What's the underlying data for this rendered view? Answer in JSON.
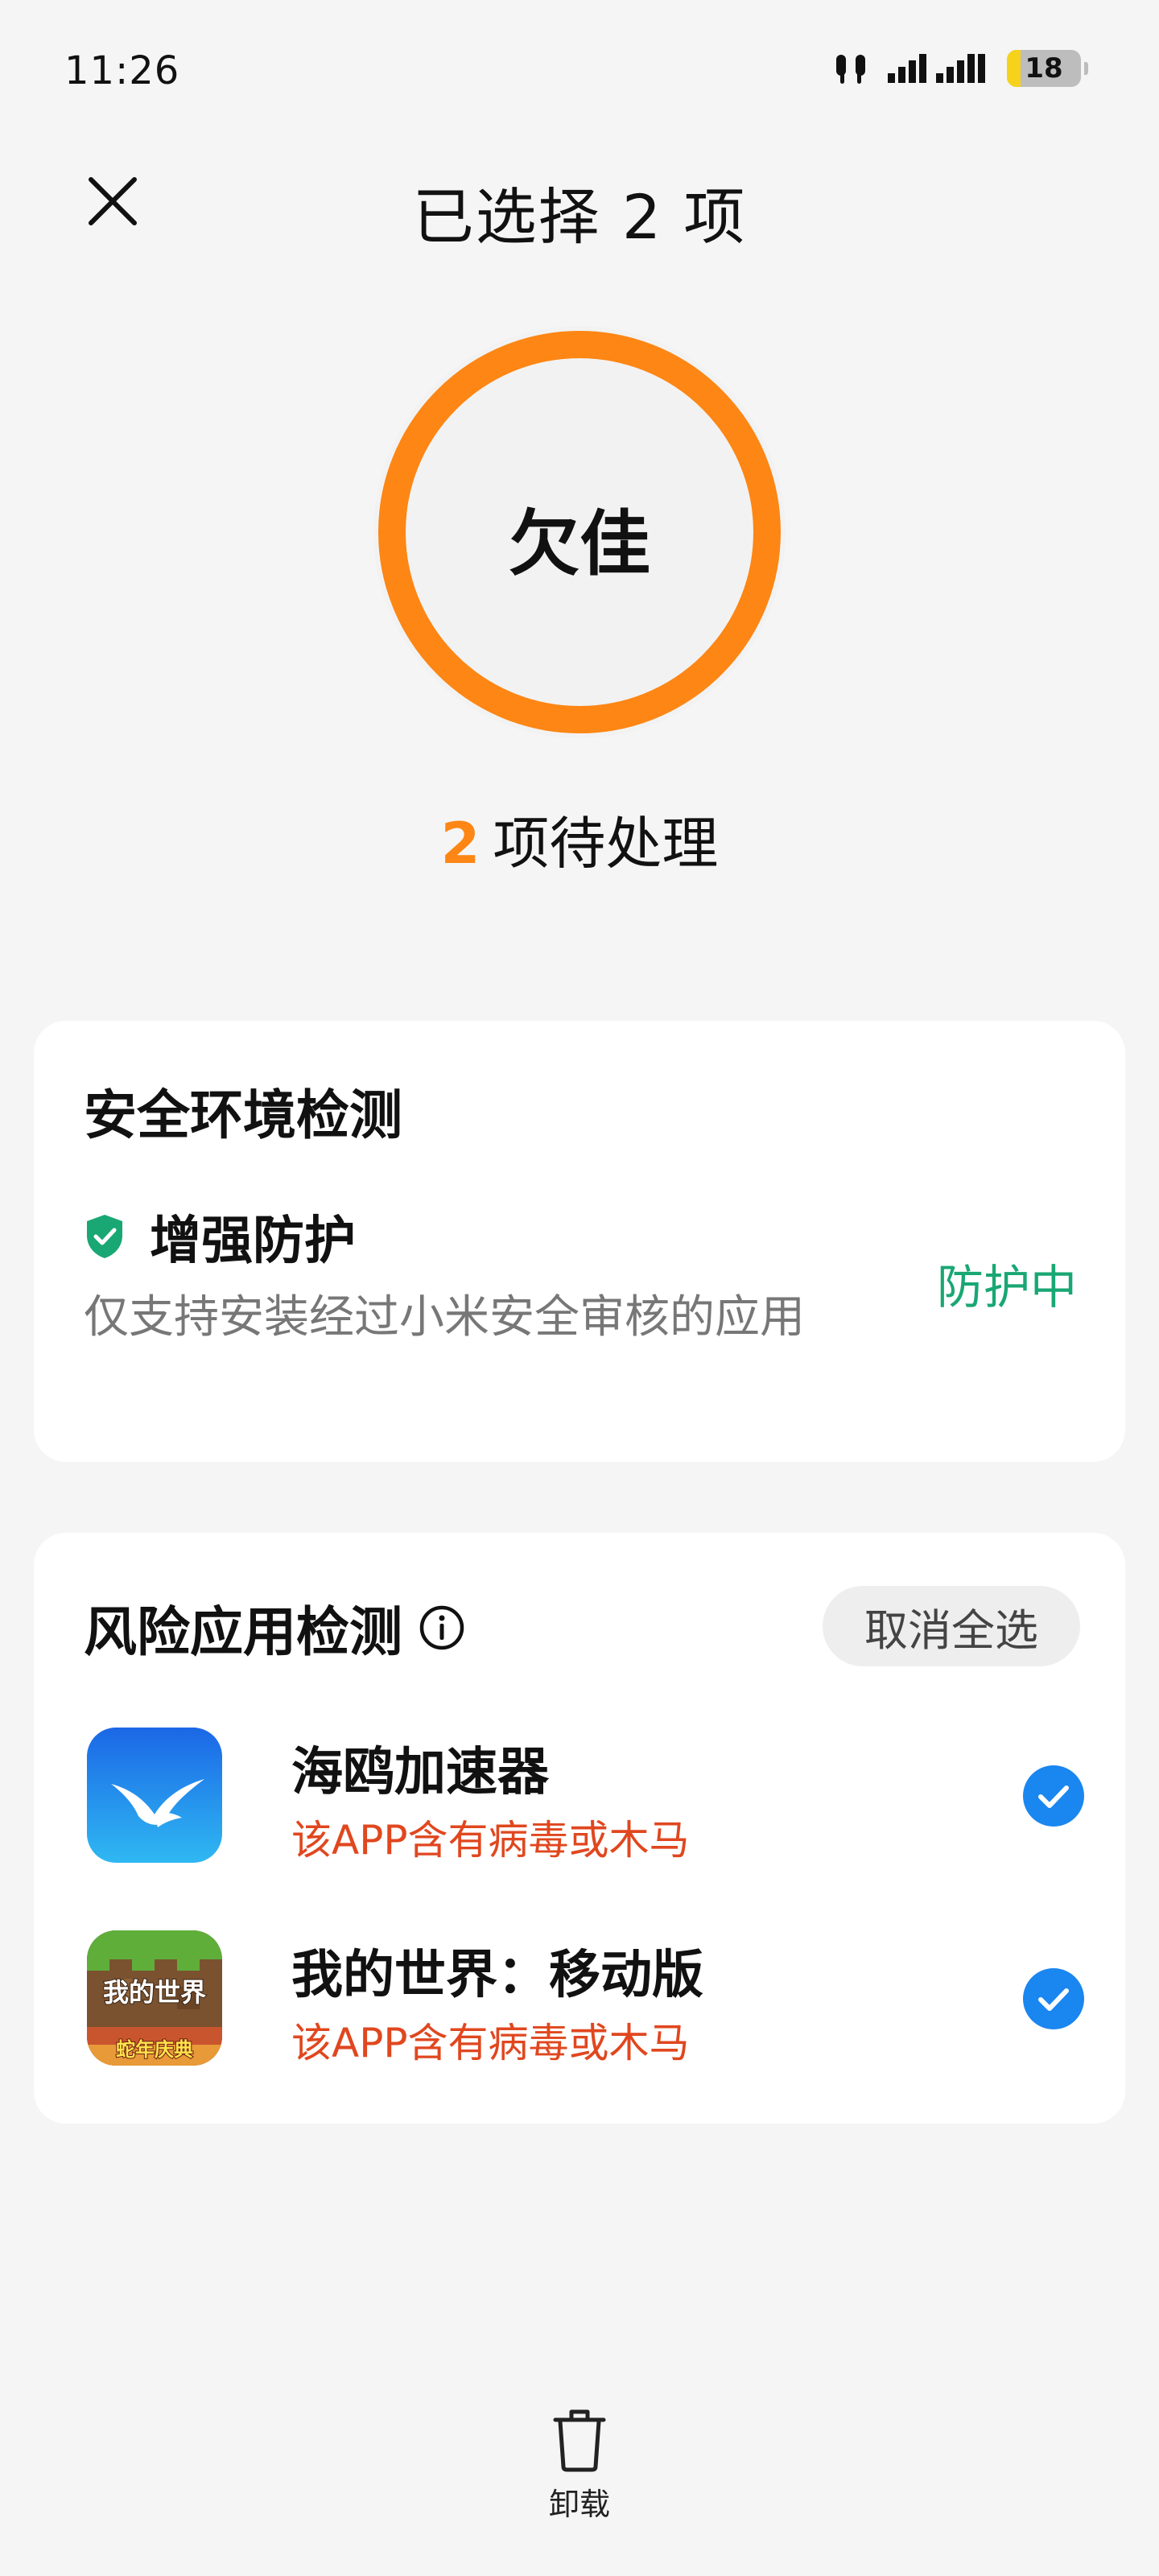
{
  "status_bar": {
    "time": "11:26",
    "battery_level": "18",
    "icons": [
      "earbuds-icon",
      "signal-icon",
      "battery-icon"
    ]
  },
  "header": {
    "title": "已选择 2 项",
    "close_icon": "close-icon"
  },
  "score": {
    "label": "欠佳",
    "ring_color": "#fd8614"
  },
  "pending": {
    "count": "2",
    "text": "项待处理"
  },
  "env_card": {
    "title": "安全环境检测",
    "item_name": "增强防护",
    "item_desc": "仅支持安装经过小米安全审核的应用",
    "item_status": "防护中",
    "status_color": "#19a774"
  },
  "risk_card": {
    "title": "风险应用检测",
    "deselect_label": "取消全选",
    "apps": [
      {
        "name": "海鸥加速器",
        "warning": "该APP含有病毒或木马",
        "checked": true,
        "icon": "seagull-app-icon"
      },
      {
        "name": "我的世界：移动版",
        "warning": "该APP含有病毒或木马",
        "checked": true,
        "icon": "minecraft-app-icon",
        "icon_text_top": "我的世界",
        "icon_text_bottom": "蛇年庆典"
      }
    ]
  },
  "bottom": {
    "uninstall_label": "卸载"
  },
  "colors": {
    "accent_orange": "#fd8614",
    "check_blue": "#1a86f0",
    "warning_red": "#e0471f"
  }
}
